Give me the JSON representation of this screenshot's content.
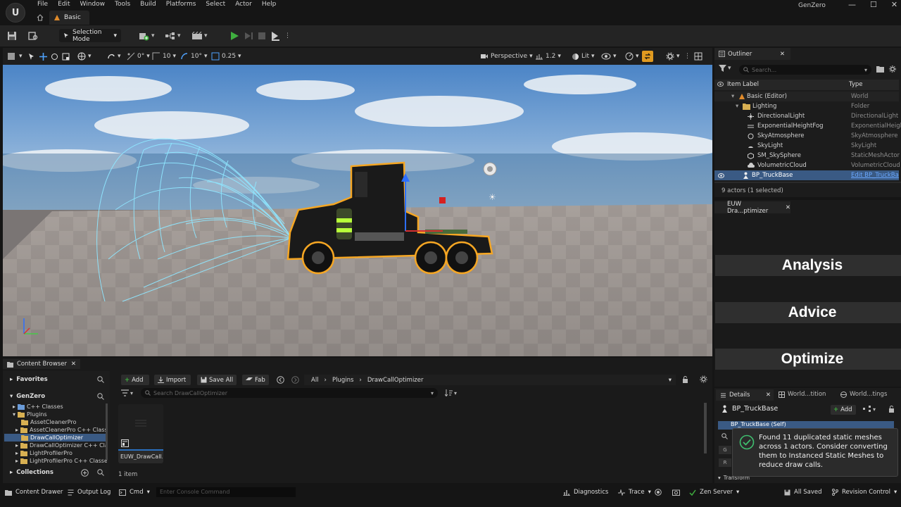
{
  "menu": [
    "File",
    "Edit",
    "Window",
    "Tools",
    "Build",
    "Platforms",
    "Select",
    "Actor",
    "Help"
  ],
  "level_tab": "Basic",
  "project_name": "GenZero",
  "window_controls": {
    "minimize": "—",
    "maximize": "☐",
    "close": "✕"
  },
  "toolbar": {
    "selection_mode": "Selection Mode"
  },
  "viewport_toolbar": {
    "rotation_snap": "0°",
    "grid_snap": "10",
    "angle_snap": "10°",
    "scale_snap": "0.25",
    "perspective": "Perspective",
    "camera_speed": "1.2",
    "lit": "Lit"
  },
  "outliner": {
    "tab": "Outliner",
    "search_placeholder": "Search...",
    "col_label": "Item Label",
    "col_type": "Type",
    "items": [
      {
        "label": "Basic (Editor)",
        "type": "World"
      },
      {
        "label": "Lighting",
        "type": "Folder"
      },
      {
        "label": "DirectionalLight",
        "type": "DirectionalLight"
      },
      {
        "label": "ExponentialHeightFog",
        "type": "ExponentialHeigh"
      },
      {
        "label": "SkyAtmosphere",
        "type": "SkyAtmosphere"
      },
      {
        "label": "SkyLight",
        "type": "SkyLight"
      },
      {
        "label": "SM_SkySphere",
        "type": "StaticMeshActor"
      },
      {
        "label": "VolumetricCloud",
        "type": "VolumetricCloud"
      },
      {
        "label": "BP_TruckBase",
        "type": "Edit BP_TruckBa"
      }
    ],
    "status": "9 actors (1 selected)"
  },
  "euw": {
    "tab": "EUW Dra...ptimizer",
    "buttons": [
      "Analysis",
      "Advice",
      "Optimize"
    ]
  },
  "details": {
    "tabs": [
      "Details",
      "World...tition",
      "World...tings"
    ],
    "actor": "BP_TruckBase",
    "add_label": "Add",
    "component_row": "BP_TruckBase (Self)",
    "letters": [
      "G",
      "R"
    ],
    "transform": "Transform"
  },
  "notification": "Found 11 duplicated static meshes across 1 actors. Consider converting them to Instanced Static Meshes to reduce draw calls.",
  "content_browser": {
    "tab": "Content Browser",
    "favorites": "Favorites",
    "project": "GenZero",
    "tree": [
      "C++ Classes",
      "Plugins",
      "AssetCleanerPro",
      "AssetCleanerPro C++ Classes",
      "DrawCallOptimizer",
      "DrawCallOptimizer C++ Classes",
      "LightProfilerPro",
      "LightProfilerPro C++ Classes"
    ],
    "collections": "Collections",
    "add": "Add",
    "import": "Import",
    "save_all": "Save All",
    "fab": "Fab",
    "path": [
      "All",
      "Plugins",
      "DrawCallOptimizer"
    ],
    "search_placeholder": "Search DrawCallOptimizer",
    "asset_name": "EUW_DrawCall...",
    "item_count": "1 item"
  },
  "statusbar": {
    "content_drawer": "Content Drawer",
    "output_log": "Output Log",
    "cmd": "Cmd",
    "console_placeholder": "Enter Console Command",
    "diagnostics": "Diagnostics",
    "trace": "Trace",
    "zen_server": "Zen Server",
    "all_saved": "All Saved",
    "revision_control": "Revision Control"
  },
  "colors": {
    "play_green": "#3fae3f",
    "selection_orange": "#f5a623",
    "notify_green": "#3fbf6f",
    "accent_blue": "#2a6fbf"
  }
}
